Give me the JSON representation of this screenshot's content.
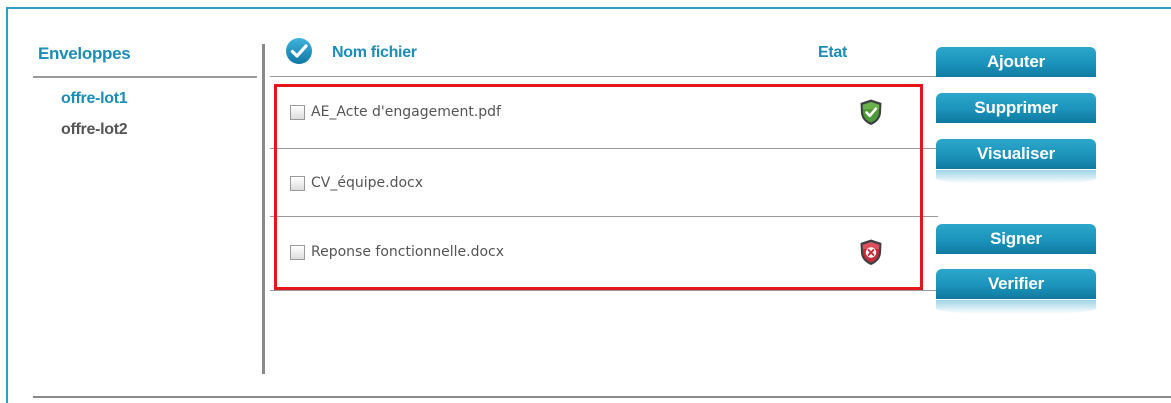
{
  "envelopes": {
    "title": "Enveloppes",
    "items": [
      {
        "label": "offre-lot1",
        "active": true
      },
      {
        "label": "offre-lot2",
        "active": false
      }
    ]
  },
  "file_list": {
    "name_header": "Nom fichier",
    "state_header": "Etat",
    "files": [
      {
        "name": "AE_Acte d'engagement.pdf",
        "checked": false,
        "state": "valid",
        "state_icon": "shield-check-icon"
      },
      {
        "name": "CV_équipe.docx",
        "checked": false,
        "state": "none",
        "state_icon": ""
      },
      {
        "name": "Reponse fonctionnelle.docx",
        "checked": false,
        "state": "invalid",
        "state_icon": "shield-x-icon"
      }
    ]
  },
  "actions": {
    "add": "Ajouter",
    "delete": "Supprimer",
    "view": "Visualiser",
    "sign": "Signer",
    "verify": "Verifier"
  },
  "colors": {
    "accent": "#1b8db8",
    "frame": "#2aa0c8",
    "highlight": "#e3171b",
    "valid": "#3f8a2e",
    "invalid": "#c0303a"
  }
}
